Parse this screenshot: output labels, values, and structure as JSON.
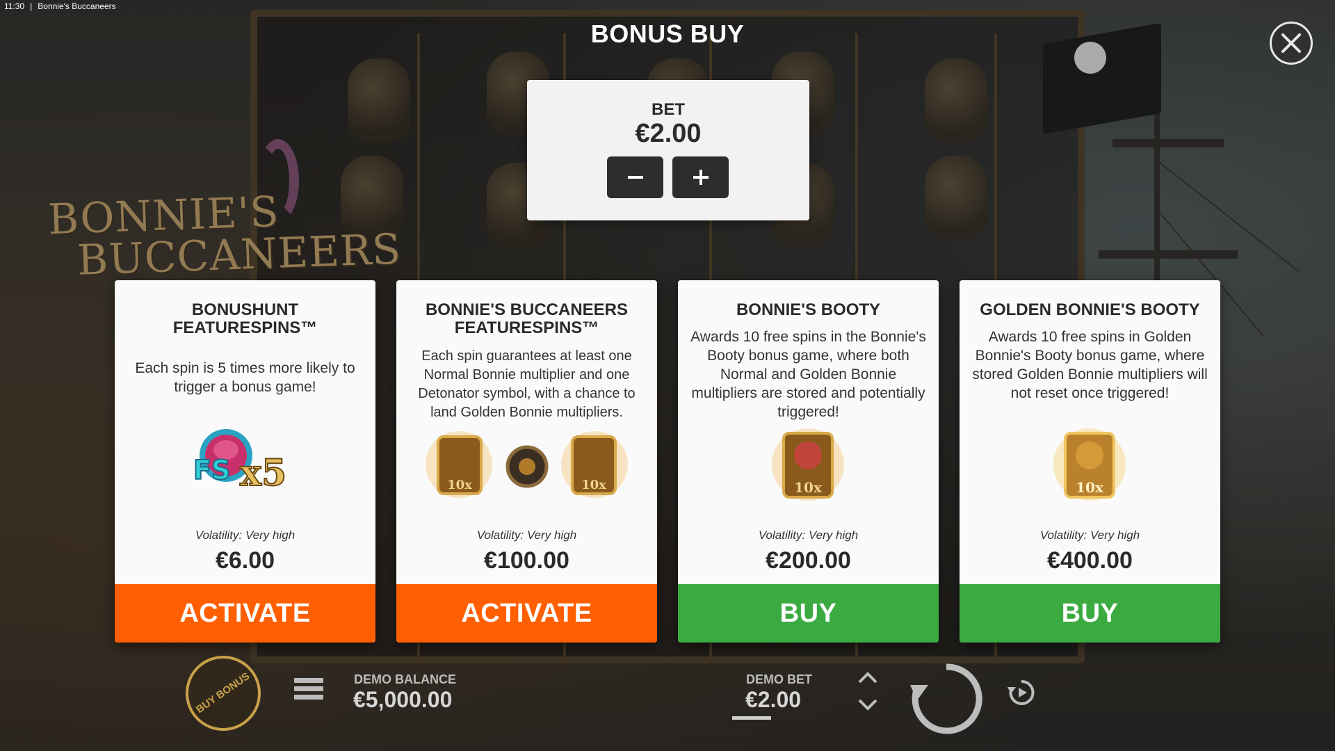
{
  "system_bar": {
    "time": "11:30",
    "separator": "|",
    "window_title": "Bonnie's Buccaneers"
  },
  "background": {
    "logo_text_line1": "BONNIE'S",
    "logo_text_line2": "BUCCANEERS"
  },
  "title": "BONUS BUY",
  "bet_panel": {
    "label": "BET",
    "value": "€2.00",
    "decrease_symbol": "minus-icon",
    "increase_symbol": "plus-icon"
  },
  "cards": [
    {
      "title": "BONUSHUNT FEATURESPINS™",
      "description": "Each spin is 5 times more likely to trigger a bonus game!",
      "image": "fs-x5-icon",
      "image_text_fs": "FS",
      "image_text_x5": "x5",
      "volatility": "Volatility: Very high",
      "price": "€6.00",
      "action": "ACTIVATE",
      "action_color": "#ff5f00"
    },
    {
      "title": "BONNIE'S BUCCANEERS FEATURESPINS™",
      "description": "Each spin guarantees at least one Normal Bonnie multiplier and one Detonator symbol, with a chance to land Golden Bonnie multipliers.",
      "image": "bonnie-multiplier-detonator-icons",
      "image_badge_left": "10x",
      "image_badge_right": "10x",
      "volatility": "Volatility: Very high",
      "price": "€100.00",
      "action": "ACTIVATE",
      "action_color": "#ff5f00"
    },
    {
      "title": "BONNIE'S BOOTY",
      "description": "Awards 10 free spins in the Bonnie's Booty bonus game, where both Normal and Golden Bonnie multipliers are stored and potentially triggered!",
      "image": "bonnie-multiplier-icon",
      "image_badge": "10x",
      "volatility": "Volatility: Very high",
      "price": "€200.00",
      "action": "BUY",
      "action_color": "#3bab41"
    },
    {
      "title": "GOLDEN BONNIE'S BOOTY",
      "description": "Awards 10 free spins in Golden Bonnie's Booty bonus game, where stored Golden Bonnie multipliers will not reset once triggered!",
      "image": "golden-bonnie-multiplier-icon",
      "image_badge": "10x",
      "volatility": "Volatility: Very high",
      "price": "€400.00",
      "action": "BUY",
      "action_color": "#3bab41"
    }
  ],
  "hud": {
    "buy_bonus_label": "BUY BONUS",
    "balance_label": "DEMO BALANCE",
    "balance_value": "€5,000.00",
    "bet_label": "DEMO BET",
    "bet_value": "€2.00"
  }
}
